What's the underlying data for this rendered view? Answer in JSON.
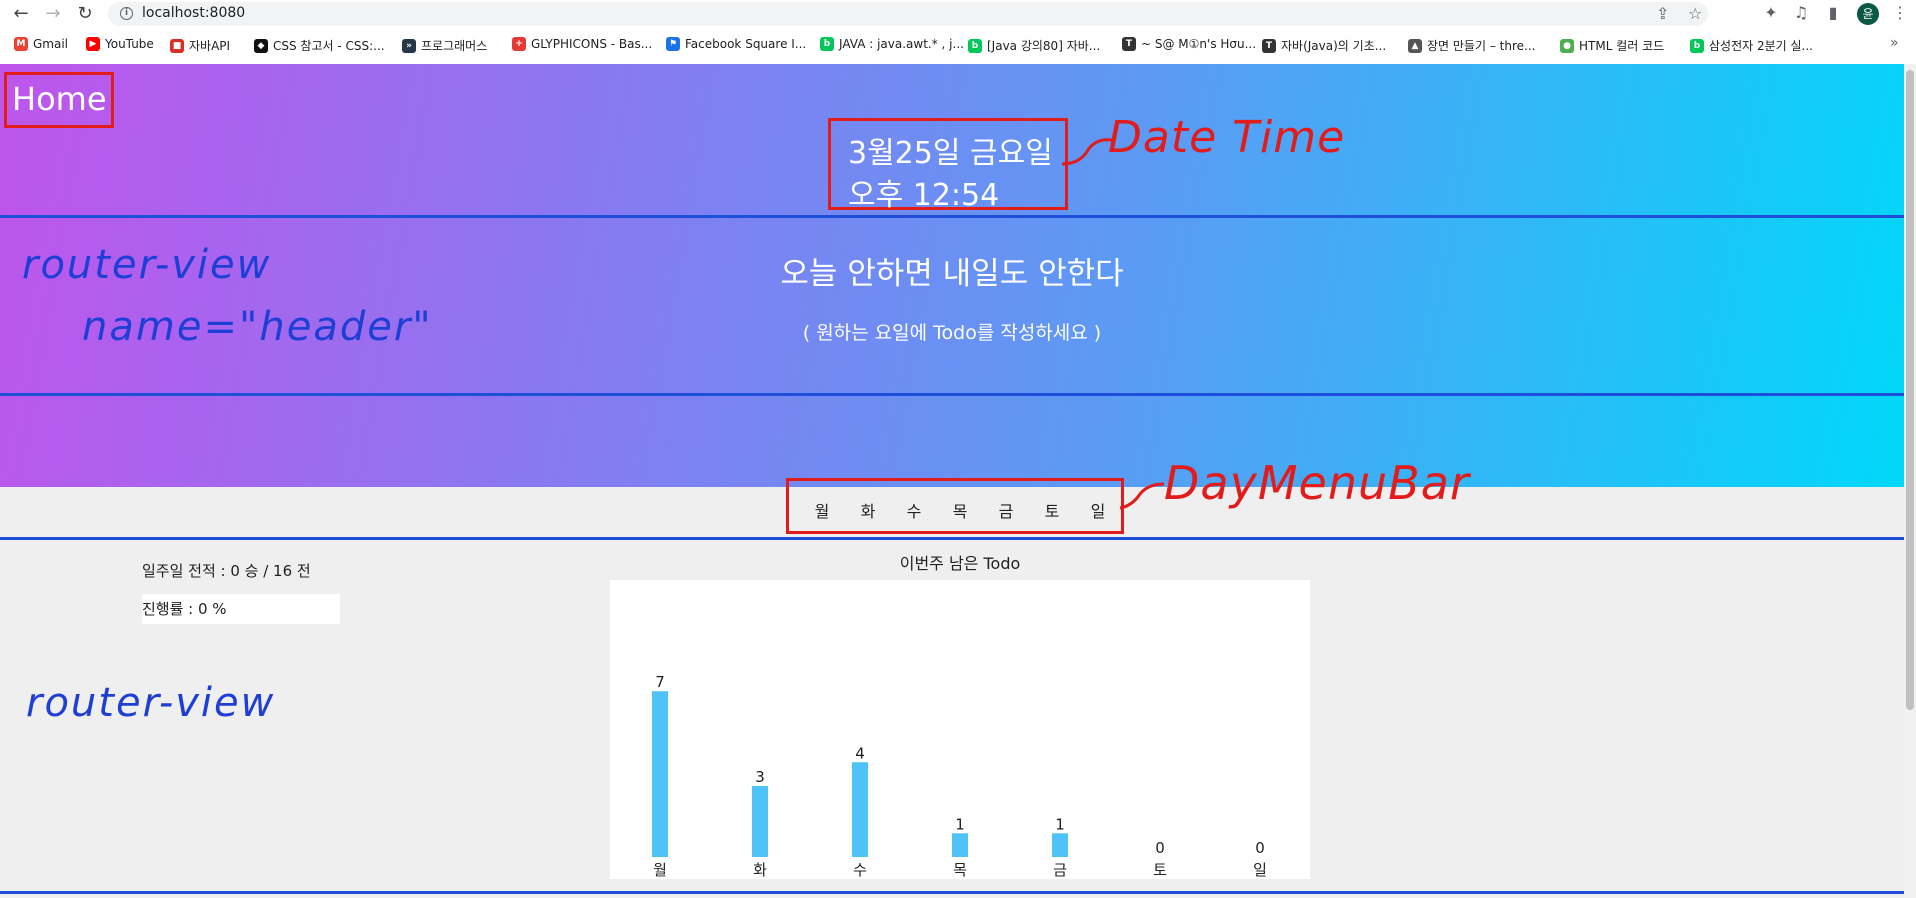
{
  "browser": {
    "url": "localhost:8080",
    "bookmarks": [
      {
        "label": "Gmail",
        "icon": "gmail-icon",
        "color": "#ea4335"
      },
      {
        "label": "YouTube",
        "icon": "youtube-icon",
        "color": "#ff0000"
      },
      {
        "label": "자바API",
        "icon": "bookmark-red-icon",
        "color": "#d93025"
      },
      {
        "label": "CSS 참고서 - CSS:...",
        "icon": "mdn-icon",
        "color": "#111111"
      },
      {
        "label": "프로그래머스",
        "icon": "programmers-icon",
        "color": "#263747"
      },
      {
        "label": "GLYPHICONS - Bas...",
        "icon": "glyphicons-icon",
        "color": "#e53935"
      },
      {
        "label": "Facebook Square I...",
        "icon": "flag-icon",
        "color": "#1a73e8"
      },
      {
        "label": "JAVA : java.awt.* , j...",
        "icon": "naver-blog-icon",
        "color": "#03c75a"
      },
      {
        "label": "[Java 강의80] 자바...",
        "icon": "naver-blog-icon",
        "color": "#03c75a"
      },
      {
        "label": "~ S@ M①n's Hσu...",
        "icon": "tistory-icon",
        "color": "#333333"
      },
      {
        "label": "자바(Java)의 기초...",
        "icon": "tistory-icon",
        "color": "#333333"
      },
      {
        "label": "장면 만들기 – thre...",
        "icon": "threejs-icon",
        "color": "#555555"
      },
      {
        "label": "HTML 컬러 코드",
        "icon": "color-wheel-icon",
        "color": "#4caf50"
      },
      {
        "label": "삼성전자 2분기 실...",
        "icon": "naver-blog-icon",
        "color": "#03c75a"
      }
    ],
    "profile_initial": "윤"
  },
  "app": {
    "home_label": "Home",
    "date_line1": "3월25일 금요일",
    "date_line2": "오후 12:54",
    "quote": "오늘 안하면 내일도 안한다",
    "subtitle": "( 원하는 요일에 Todo를 작성하세요 )",
    "days": [
      "월",
      "화",
      "수",
      "목",
      "금",
      "토",
      "일"
    ],
    "record_text": "일주일 전적 : 0 승 / 16 전",
    "progress_text": "진행률 : 0 %"
  },
  "annotations": {
    "datetime": "Date Time",
    "header_view1": "router-view",
    "header_view2": "name=\"header\"",
    "daymenubar": "DayMenuBar",
    "main_view": "router-view"
  },
  "colors": {
    "annotation_red": "#e21b1b",
    "annotation_blue": "#1d4fd8",
    "bar": "#4fc3f7"
  },
  "chart_data": {
    "type": "bar",
    "title": "이번주 남은 Todo",
    "categories": [
      "월",
      "화",
      "수",
      "목",
      "금",
      "토",
      "일"
    ],
    "values": [
      7,
      3,
      4,
      1,
      1,
      0,
      0
    ],
    "ylim": [
      0,
      10
    ]
  }
}
